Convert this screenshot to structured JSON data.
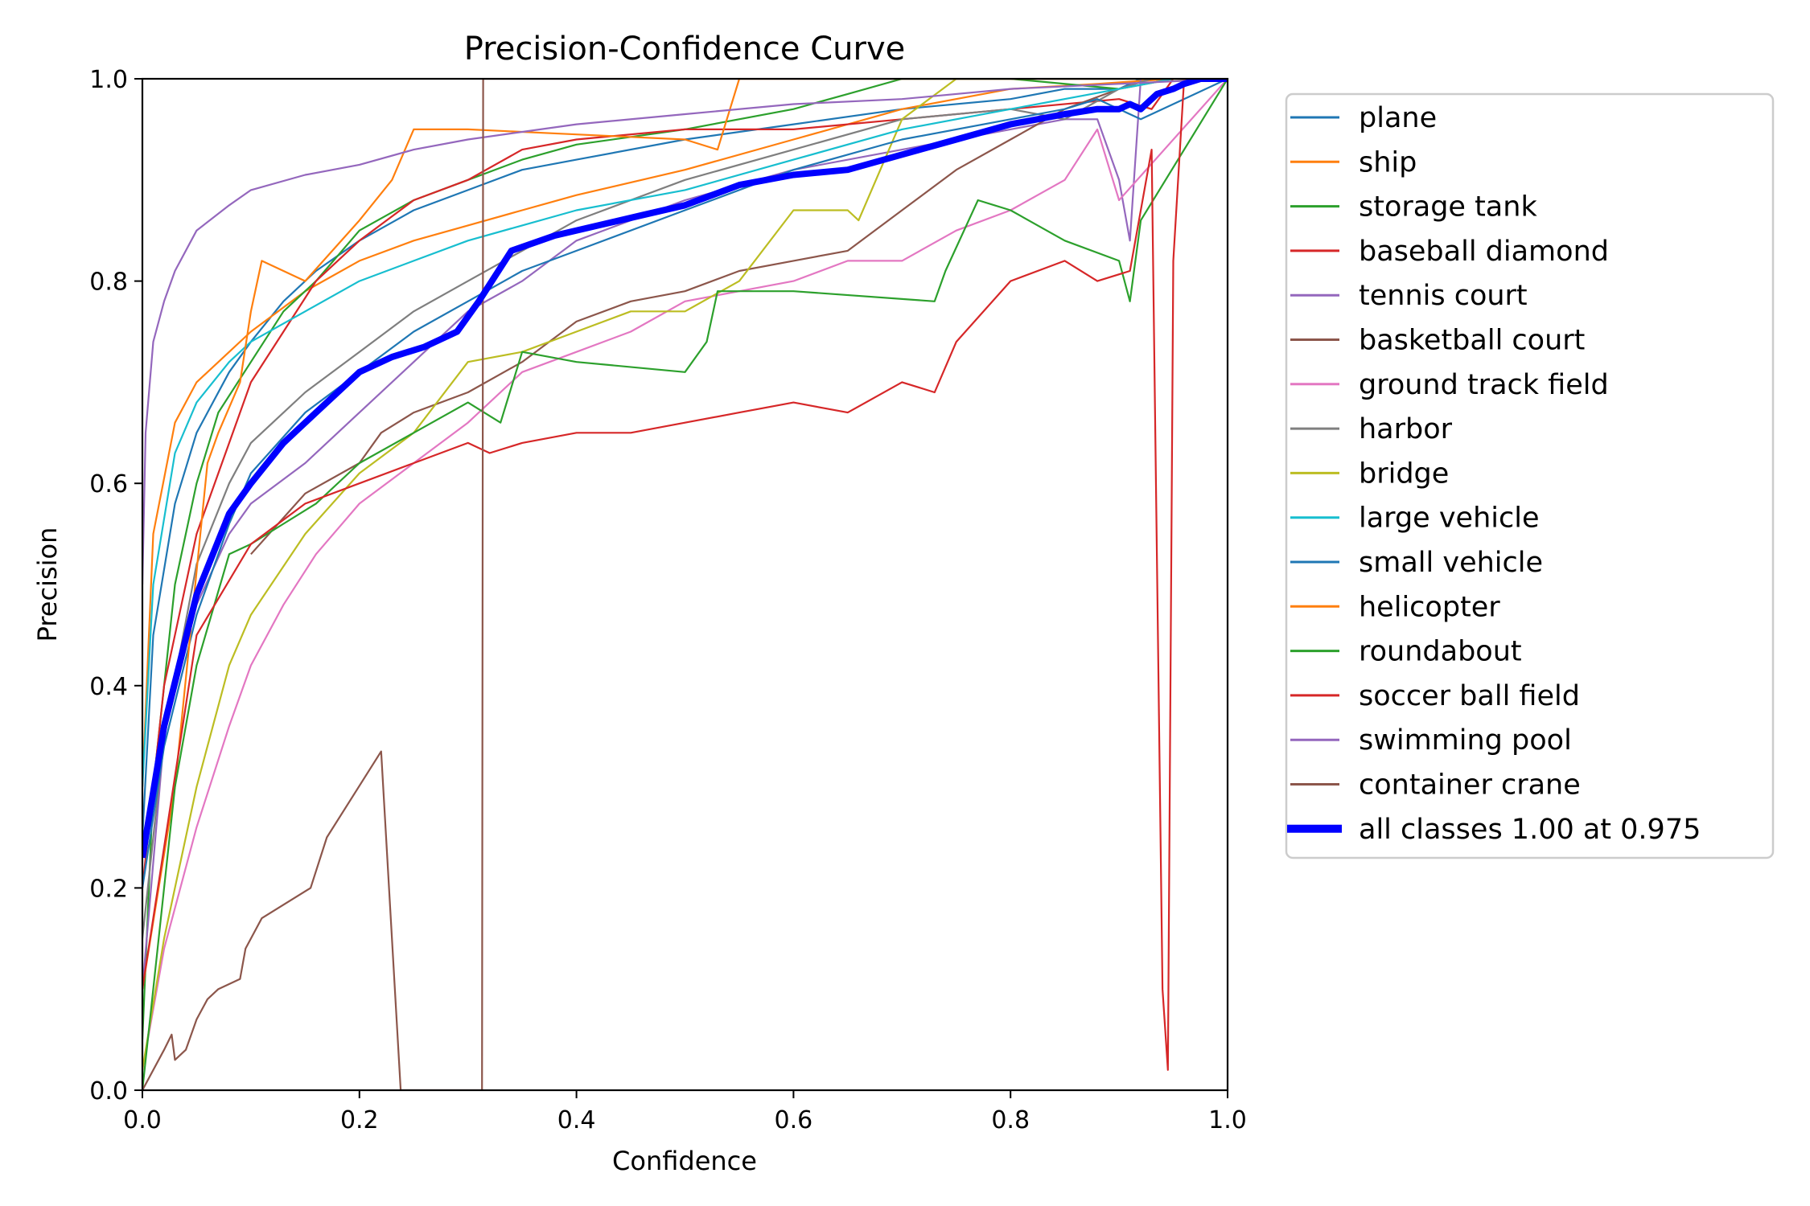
{
  "chart_data": {
    "type": "line",
    "title": "Precision-Confidence Curve",
    "xlabel": "Confidence",
    "ylabel": "Precision",
    "xlim": [
      0,
      1
    ],
    "ylim": [
      0,
      1
    ],
    "xticks": [
      "0.0",
      "0.2",
      "0.4",
      "0.6",
      "0.8",
      "1.0"
    ],
    "yticks": [
      "0.0",
      "0.2",
      "0.4",
      "0.6",
      "0.8",
      "1.0"
    ],
    "grid": false,
    "legend_position": "outside-right",
    "series": [
      {
        "name": "plane",
        "color": "#1f77b4",
        "width": 1,
        "x": [
          0.0,
          0.01,
          0.03,
          0.05,
          0.08,
          0.1,
          0.13,
          0.16,
          0.2,
          0.25,
          0.3,
          0.35,
          0.4,
          0.5,
          0.6,
          0.7,
          0.8,
          0.85,
          0.9,
          0.92,
          1.0
        ],
        "y": [
          0.25,
          0.45,
          0.58,
          0.65,
          0.71,
          0.74,
          0.78,
          0.81,
          0.84,
          0.87,
          0.89,
          0.91,
          0.92,
          0.94,
          0.955,
          0.97,
          0.98,
          0.99,
          0.99,
          1.0,
          1.0
        ]
      },
      {
        "name": "ship",
        "color": "#ff7f0e",
        "width": 1,
        "x": [
          0.0,
          0.01,
          0.03,
          0.05,
          0.08,
          0.1,
          0.15,
          0.2,
          0.25,
          0.3,
          0.35,
          0.4,
          0.5,
          0.6,
          0.7,
          0.8,
          0.88,
          0.95,
          1.0
        ],
        "y": [
          0.3,
          0.55,
          0.66,
          0.7,
          0.73,
          0.75,
          0.79,
          0.82,
          0.84,
          0.855,
          0.87,
          0.885,
          0.91,
          0.94,
          0.97,
          0.99,
          0.995,
          1.0,
          1.0
        ]
      },
      {
        "name": "storage tank",
        "color": "#2ca02c",
        "width": 1,
        "x": [
          0.0,
          0.01,
          0.03,
          0.05,
          0.07,
          0.1,
          0.13,
          0.16,
          0.2,
          0.25,
          0.3,
          0.35,
          0.4,
          0.5,
          0.6,
          0.65,
          0.7,
          0.8,
          0.9,
          0.95,
          1.0
        ],
        "y": [
          0.05,
          0.3,
          0.5,
          0.6,
          0.67,
          0.72,
          0.77,
          0.8,
          0.85,
          0.88,
          0.9,
          0.92,
          0.935,
          0.95,
          0.97,
          0.985,
          1.0,
          1.0,
          0.99,
          1.0,
          1.0
        ]
      },
      {
        "name": "baseball diamond",
        "color": "#d62728",
        "width": 1,
        "x": [
          0.0,
          0.02,
          0.05,
          0.08,
          0.1,
          0.13,
          0.16,
          0.2,
          0.25,
          0.3,
          0.35,
          0.4,
          0.5,
          0.6,
          0.7,
          0.8,
          0.9,
          0.93,
          0.95,
          1.0
        ],
        "y": [
          0.2,
          0.4,
          0.55,
          0.64,
          0.7,
          0.75,
          0.8,
          0.84,
          0.88,
          0.9,
          0.93,
          0.94,
          0.95,
          0.95,
          0.96,
          0.97,
          0.98,
          0.97,
          1.0,
          1.0
        ]
      },
      {
        "name": "tennis court",
        "color": "#9467bd",
        "width": 1,
        "x": [
          0.0,
          0.02,
          0.05,
          0.08,
          0.1,
          0.15,
          0.2,
          0.25,
          0.3,
          0.35,
          0.4,
          0.5,
          0.6,
          0.7,
          0.8,
          0.85,
          0.88,
          0.9,
          0.91,
          0.92,
          1.0
        ],
        "y": [
          0.1,
          0.35,
          0.48,
          0.55,
          0.58,
          0.62,
          0.67,
          0.72,
          0.77,
          0.8,
          0.84,
          0.88,
          0.91,
          0.93,
          0.95,
          0.96,
          0.96,
          0.9,
          0.84,
          1.0,
          1.0
        ]
      },
      {
        "name": "basketball court",
        "color": "#8c564b",
        "width": 1,
        "x": [
          0.1,
          0.15,
          0.2,
          0.22,
          0.25,
          0.3,
          0.35,
          0.4,
          0.45,
          0.5,
          0.55,
          0.6,
          0.65,
          0.7,
          0.75,
          0.8,
          0.85,
          0.9,
          0.93,
          1.0
        ],
        "y": [
          0.53,
          0.59,
          0.62,
          0.65,
          0.67,
          0.69,
          0.72,
          0.76,
          0.78,
          0.79,
          0.81,
          0.82,
          0.83,
          0.87,
          0.91,
          0.94,
          0.97,
          0.99,
          1.0,
          1.0
        ]
      },
      {
        "name": "ground track field",
        "color": "#e377c2",
        "width": 1,
        "x": [
          0.0,
          0.02,
          0.05,
          0.08,
          0.1,
          0.13,
          0.16,
          0.2,
          0.25,
          0.3,
          0.35,
          0.4,
          0.45,
          0.5,
          0.55,
          0.6,
          0.65,
          0.7,
          0.75,
          0.8,
          0.85,
          0.88,
          0.9,
          1.0
        ],
        "y": [
          0.02,
          0.14,
          0.26,
          0.36,
          0.42,
          0.48,
          0.53,
          0.58,
          0.62,
          0.66,
          0.71,
          0.73,
          0.75,
          0.78,
          0.79,
          0.8,
          0.82,
          0.82,
          0.85,
          0.87,
          0.9,
          0.95,
          0.88,
          1.0
        ]
      },
      {
        "name": "harbor",
        "color": "#7f7f7f",
        "width": 1,
        "x": [
          0.0,
          0.02,
          0.05,
          0.08,
          0.1,
          0.15,
          0.2,
          0.25,
          0.3,
          0.35,
          0.4,
          0.5,
          0.6,
          0.7,
          0.8,
          0.85,
          0.9,
          0.93,
          1.0
        ],
        "y": [
          0.15,
          0.35,
          0.52,
          0.6,
          0.64,
          0.69,
          0.73,
          0.77,
          0.8,
          0.83,
          0.86,
          0.9,
          0.93,
          0.96,
          0.97,
          0.96,
          0.99,
          1.0,
          1.0
        ]
      },
      {
        "name": "bridge",
        "color": "#bcbd22",
        "width": 1,
        "x": [
          0.0,
          0.02,
          0.05,
          0.08,
          0.1,
          0.15,
          0.2,
          0.25,
          0.3,
          0.35,
          0.4,
          0.45,
          0.5,
          0.55,
          0.6,
          0.65,
          0.66,
          0.7,
          0.75,
          0.8,
          1.0
        ],
        "y": [
          0.02,
          0.15,
          0.3,
          0.42,
          0.47,
          0.55,
          0.61,
          0.65,
          0.72,
          0.73,
          0.75,
          0.77,
          0.77,
          0.8,
          0.87,
          0.87,
          0.86,
          0.96,
          1.0,
          1.0,
          1.0
        ]
      },
      {
        "name": "large vehicle",
        "color": "#17becf",
        "width": 1,
        "x": [
          0.0,
          0.01,
          0.03,
          0.05,
          0.08,
          0.1,
          0.15,
          0.2,
          0.25,
          0.3,
          0.35,
          0.4,
          0.5,
          0.6,
          0.7,
          0.8,
          0.9,
          0.95,
          1.0
        ],
        "y": [
          0.3,
          0.5,
          0.63,
          0.68,
          0.72,
          0.74,
          0.77,
          0.8,
          0.82,
          0.84,
          0.855,
          0.87,
          0.89,
          0.92,
          0.95,
          0.97,
          0.99,
          1.0,
          1.0
        ]
      },
      {
        "name": "small vehicle",
        "color": "#1f77b4",
        "width": 1,
        "x": [
          0.0,
          0.02,
          0.05,
          0.08,
          0.1,
          0.15,
          0.2,
          0.25,
          0.3,
          0.35,
          0.4,
          0.5,
          0.6,
          0.7,
          0.8,
          0.85,
          0.88,
          0.92,
          1.0
        ],
        "y": [
          0.2,
          0.34,
          0.47,
          0.56,
          0.61,
          0.67,
          0.71,
          0.75,
          0.78,
          0.81,
          0.83,
          0.87,
          0.91,
          0.94,
          0.96,
          0.97,
          0.98,
          0.96,
          1.0
        ]
      },
      {
        "name": "helicopter",
        "color": "#ff7f0e",
        "width": 1,
        "x": [
          0.0,
          0.03,
          0.06,
          0.07,
          0.09,
          0.1,
          0.11,
          0.15,
          0.2,
          0.23,
          0.25,
          0.3,
          0.4,
          0.5,
          0.53,
          0.55,
          1.0
        ],
        "y": [
          0.1,
          0.3,
          0.62,
          0.65,
          0.7,
          0.77,
          0.82,
          0.8,
          0.86,
          0.9,
          0.95,
          0.95,
          0.945,
          0.94,
          0.93,
          1.0,
          1.0
        ]
      },
      {
        "name": "roundabout",
        "color": "#2ca02c",
        "width": 1,
        "x": [
          0.0,
          0.03,
          0.05,
          0.08,
          0.1,
          0.13,
          0.16,
          0.2,
          0.25,
          0.3,
          0.33,
          0.35,
          0.4,
          0.5,
          0.52,
          0.53,
          0.6,
          0.73,
          0.74,
          0.77,
          0.8,
          0.85,
          0.9,
          0.91,
          0.92,
          1.0
        ],
        "y": [
          0.0,
          0.3,
          0.42,
          0.53,
          0.54,
          0.56,
          0.58,
          0.62,
          0.65,
          0.68,
          0.66,
          0.73,
          0.72,
          0.71,
          0.74,
          0.79,
          0.79,
          0.78,
          0.81,
          0.88,
          0.87,
          0.84,
          0.82,
          0.78,
          0.86,
          1.0
        ]
      },
      {
        "name": "soccer ball field",
        "color": "#d62728",
        "width": 1,
        "x": [
          0.0,
          0.05,
          0.1,
          0.15,
          0.2,
          0.25,
          0.3,
          0.32,
          0.35,
          0.4,
          0.45,
          0.5,
          0.55,
          0.6,
          0.65,
          0.7,
          0.73,
          0.75,
          0.8,
          0.85,
          0.88,
          0.91,
          0.93,
          0.94,
          0.945,
          0.95,
          0.96,
          1.0
        ],
        "y": [
          0.1,
          0.45,
          0.54,
          0.58,
          0.6,
          0.62,
          0.64,
          0.63,
          0.64,
          0.65,
          0.65,
          0.66,
          0.67,
          0.68,
          0.67,
          0.7,
          0.69,
          0.74,
          0.8,
          0.82,
          0.8,
          0.81,
          0.93,
          0.1,
          0.02,
          0.82,
          1.0,
          1.0
        ]
      },
      {
        "name": "swimming pool",
        "color": "#9467bd",
        "width": 1,
        "x": [
          0.0,
          0.003,
          0.01,
          0.02,
          0.03,
          0.05,
          0.08,
          0.1,
          0.15,
          0.2,
          0.25,
          0.3,
          0.4,
          0.5,
          0.6,
          0.7,
          0.8,
          0.9,
          1.0
        ],
        "y": [
          0.5,
          0.65,
          0.74,
          0.78,
          0.81,
          0.85,
          0.875,
          0.89,
          0.905,
          0.915,
          0.93,
          0.94,
          0.955,
          0.965,
          0.975,
          0.98,
          0.99,
          0.995,
          1.0
        ]
      },
      {
        "name": "container crane",
        "color": "#8c564b",
        "width": 1,
        "x": [
          0.0,
          0.02,
          0.027,
          0.03,
          0.04,
          0.05,
          0.06,
          0.07,
          0.09,
          0.095,
          0.11,
          0.155,
          0.17,
          0.22,
          0.238,
          0.313,
          0.314,
          1.0
        ],
        "y": [
          0.0,
          0.04,
          0.055,
          0.03,
          0.04,
          0.07,
          0.09,
          0.1,
          0.11,
          0.14,
          0.17,
          0.2,
          0.25,
          0.335,
          0.0,
          0.0,
          1.0,
          1.0
        ]
      },
      {
        "name": "all classes 1.00 at 0.975",
        "color": "#0000ff",
        "width": 4,
        "x": [
          0.0,
          0.02,
          0.05,
          0.08,
          0.1,
          0.13,
          0.16,
          0.2,
          0.23,
          0.26,
          0.29,
          0.31,
          0.34,
          0.38,
          0.42,
          0.46,
          0.5,
          0.55,
          0.6,
          0.65,
          0.7,
          0.75,
          0.8,
          0.85,
          0.88,
          0.9,
          0.91,
          0.92,
          0.935,
          0.95,
          0.96,
          0.975,
          1.0
        ],
        "y": [
          0.23,
          0.36,
          0.49,
          0.57,
          0.6,
          0.64,
          0.67,
          0.71,
          0.725,
          0.735,
          0.75,
          0.78,
          0.83,
          0.845,
          0.855,
          0.865,
          0.875,
          0.895,
          0.905,
          0.91,
          0.925,
          0.94,
          0.955,
          0.965,
          0.97,
          0.97,
          0.975,
          0.97,
          0.985,
          0.99,
          0.995,
          1.0,
          1.0
        ]
      }
    ]
  }
}
